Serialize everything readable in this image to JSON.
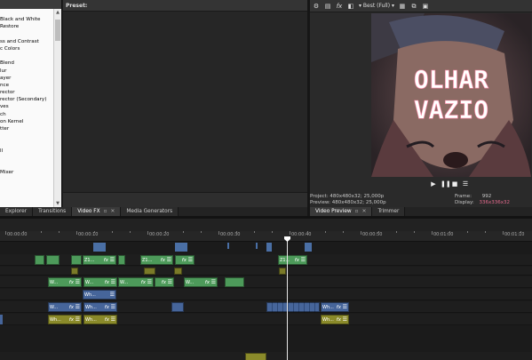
{
  "plugin_list": {
    "items": [
      "",
      "Black and White",
      "Restore",
      "",
      "ss and Contrast",
      "c Colors",
      "",
      "Blend",
      "lur",
      "ayer",
      "nce",
      "rector",
      "rector (Secondary)",
      "ves",
      "ch",
      "on Kernel",
      "tter",
      "",
      "",
      "ll",
      "",
      "",
      "Mixer"
    ]
  },
  "preset": {
    "label": "Preset:"
  },
  "preview": {
    "quality": "Best (Full)",
    "title_line1": "OLHAR",
    "title_line2": "VAZIO",
    "project_label": "Project:",
    "project_value": "480x480x32; 25,000p",
    "preview_label": "Preview:",
    "preview_value": "480x480x32; 25,000p",
    "frame_label": "Frame:",
    "frame_value": "992",
    "display_label": "Display:",
    "display_value": "336x336x32",
    "accent_color": "#e36a8d"
  },
  "tabs_left": [
    {
      "label": "Explorer"
    },
    {
      "label": "Transitions"
    },
    {
      "label": "Video FX"
    },
    {
      "label": "Media Generators"
    }
  ],
  "tabs_right": [
    {
      "label": "Video Preview"
    },
    {
      "label": "Trimmer"
    }
  ],
  "ruler": {
    "labels": [
      "00:00:00",
      "00:00:10",
      "00:00:20",
      "00:00:30",
      "00:00:40",
      "00:00:50",
      "00:01:00",
      "00:01:10"
    ]
  },
  "clip_labels": {
    "z1": "Z1...",
    "w": "W...",
    "wh": "Wh...",
    "fx_symbol": "fx",
    "menu_symbol": "☰"
  },
  "colors": {
    "video_clip": "#4d9a5a",
    "image_clip": "#46659a",
    "audio_clip": "#8a8a2a"
  }
}
